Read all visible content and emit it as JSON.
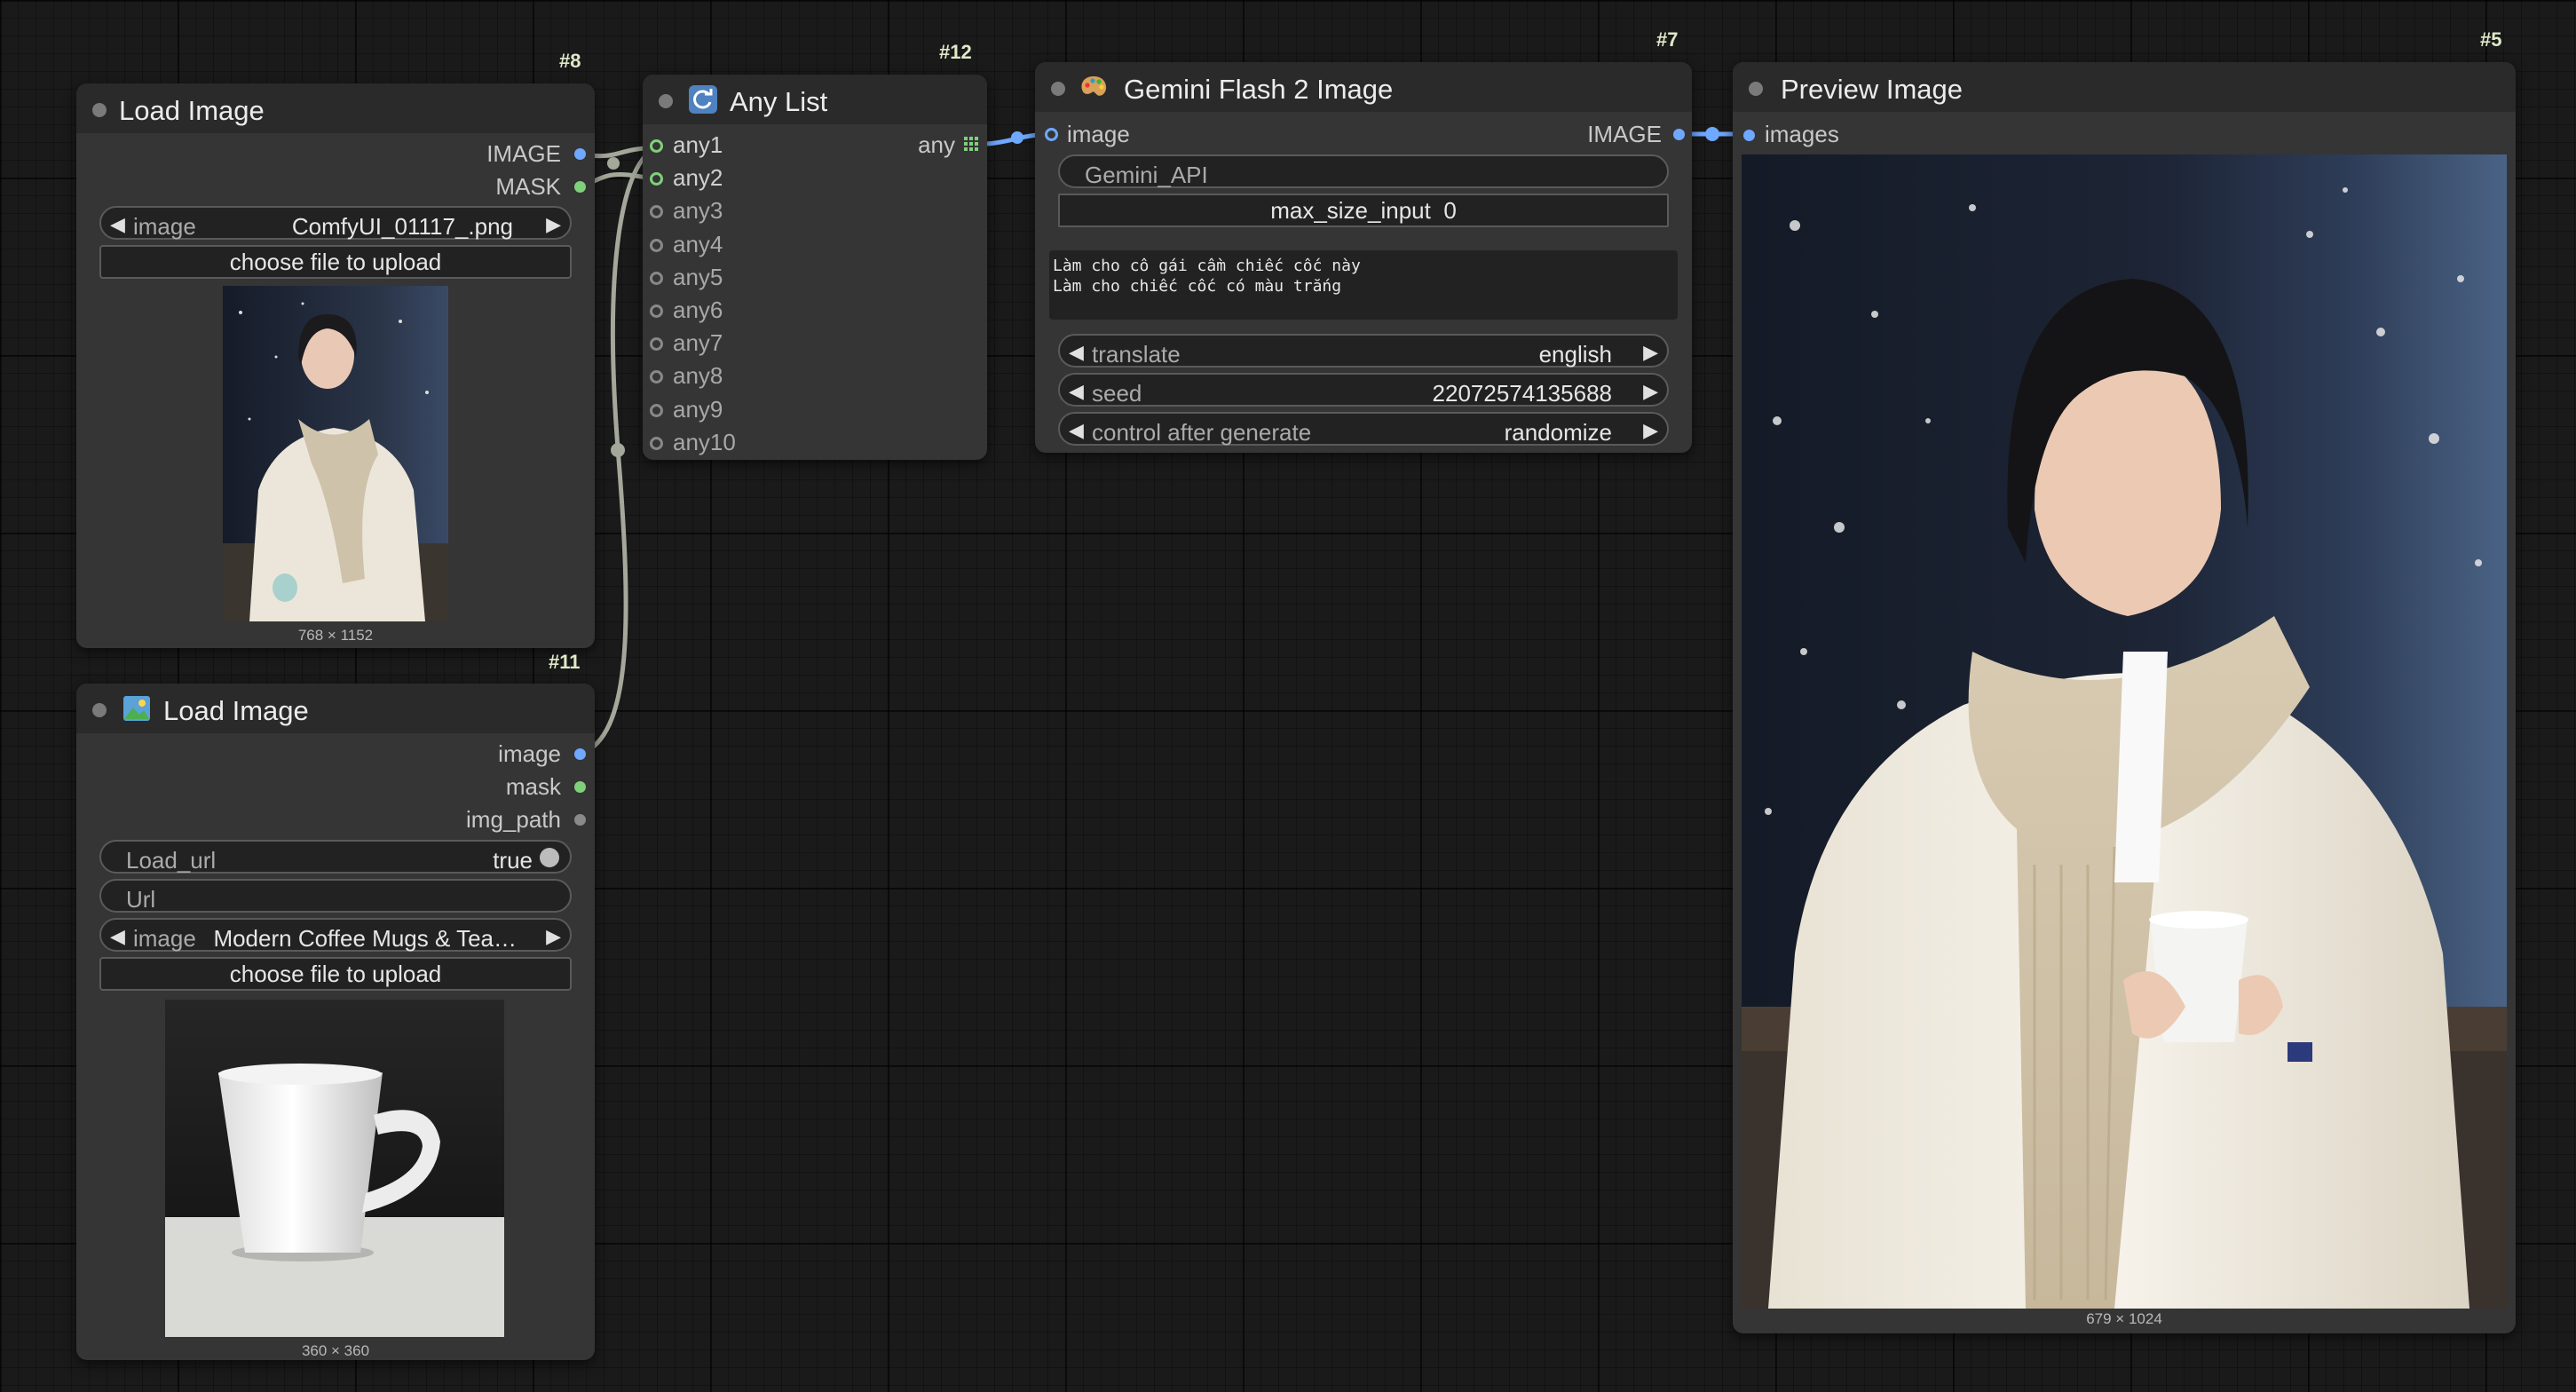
{
  "colors": {
    "canvas": "#1a1a1a",
    "node_body": "#353535",
    "node_header": "#2a2a2a",
    "link_blue": "#6fa8ff",
    "link_gray": "#a3a89a",
    "node_id": "#dfe9c8"
  },
  "nodes": {
    "n8": {
      "id": "#8",
      "title": "Load Image",
      "outputs": [
        "IMAGE",
        "MASK"
      ],
      "image_widget": {
        "label": "image",
        "value": "ComfyUI_01117_.png"
      },
      "upload_label": "choose file to upload",
      "caption": "768 × 1152"
    },
    "n11": {
      "id": "#11",
      "title": "Load Image",
      "icon": "landscape-picture-icon",
      "outputs": [
        "image",
        "mask",
        "img_path"
      ],
      "load_url": {
        "label": "Load_url",
        "value": "true"
      },
      "url": {
        "label": "Url"
      },
      "image_widget": {
        "label": "image",
        "value": "Modern Coffee Mugs & Tea…"
      },
      "upload_label": "choose file to upload",
      "caption": "360 × 360"
    },
    "n12": {
      "id": "#12",
      "title": "Any List",
      "icon": "refresh-icon",
      "inputs": [
        "any1",
        "any2",
        "any3",
        "any4",
        "any5",
        "any6",
        "any7",
        "any8",
        "any9",
        "any10"
      ],
      "output": "any"
    },
    "n7": {
      "id": "#7",
      "title": "Gemini Flash 2 Image",
      "icon": "palette-icon",
      "input": "image",
      "output": "IMAGE",
      "api_field": "Gemini_API",
      "max_size": {
        "label": "max_size_input",
        "value": "0"
      },
      "prompt": "Làm cho cô gái cầm chiếc cốc này\nLàm cho chiếc cốc có màu trắng",
      "translate": {
        "label": "translate",
        "value": "english"
      },
      "seed": {
        "label": "seed",
        "value": "22072574135688"
      },
      "control": {
        "label": "control after generate",
        "value": "randomize"
      }
    },
    "n5": {
      "id": "#5",
      "title": "Preview Image",
      "input": "images",
      "caption": "679 × 1024"
    }
  }
}
